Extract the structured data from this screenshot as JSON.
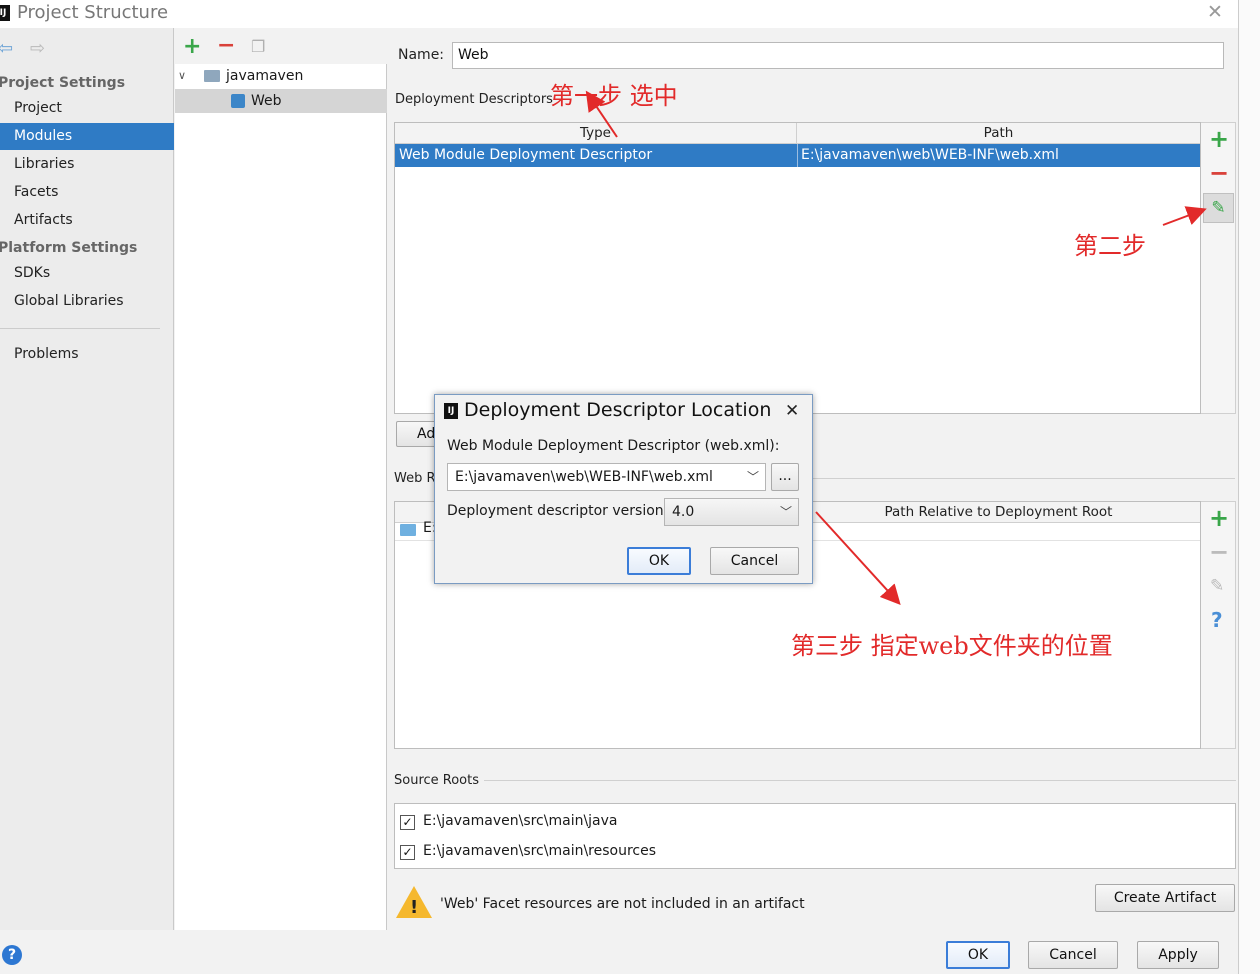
{
  "window": {
    "title": "Project Structure",
    "logo_text": "IJ"
  },
  "sidebar": {
    "project_settings_header": "Project Settings",
    "items_project": [
      {
        "label": "Project"
      },
      {
        "label": "Modules"
      },
      {
        "label": "Libraries"
      },
      {
        "label": "Facets"
      },
      {
        "label": "Artifacts"
      }
    ],
    "platform_settings_header": "Platform Settings",
    "items_platform": [
      {
        "label": "SDKs"
      },
      {
        "label": "Global Libraries"
      }
    ],
    "problems": "Problems",
    "selected": "Modules"
  },
  "module_tree": {
    "root": "javamaven",
    "child": "Web"
  },
  "facet": {
    "name_label": "Name:",
    "name_value": "Web",
    "deployment_descriptors_label": "Deployment Descriptors",
    "dd_columns": [
      "Type",
      "Path"
    ],
    "dd_rows": [
      {
        "type": "Web Module Deployment Descriptor",
        "path": "E:\\javamaven\\web\\WEB-INF\\web.xml"
      }
    ],
    "add_app_server_btn_partial": "Ad",
    "web_resource_label_partial": "Web R",
    "wr_column_right": "Path Relative to Deployment Root",
    "wr_row_partial": "E:",
    "source_roots_label": "Source Roots",
    "source_roots": [
      {
        "path": "E:\\javamaven\\src\\main\\java",
        "checked": true
      },
      {
        "path": "E:\\javamaven\\src\\main\\resources",
        "checked": true
      }
    ],
    "warning_text": "'Web' Facet resources are not included in an artifact",
    "create_artifact_btn": "Create Artifact"
  },
  "dialog": {
    "title": "Deployment Descriptor Location",
    "descriptor_label": "Web Module Deployment Descriptor (web.xml):",
    "descriptor_value": "E:\\javamaven\\web\\WEB-INF\\web.xml",
    "browse_btn": "...",
    "version_label": "Deployment descriptor version",
    "version_value": "4.0",
    "ok": "OK",
    "cancel": "Cancel"
  },
  "annotations": {
    "step1": "第一步 选中",
    "step2": "第二步",
    "step3": "第三步 指定web文件夹的位置"
  },
  "footer": {
    "ok": "OK",
    "cancel": "Cancel",
    "apply": "Apply",
    "help": "?"
  },
  "colors": {
    "selection": "#2f7bc5",
    "annotation": "#e22a2a",
    "add": "#3aa64a",
    "remove": "#d9413a"
  }
}
